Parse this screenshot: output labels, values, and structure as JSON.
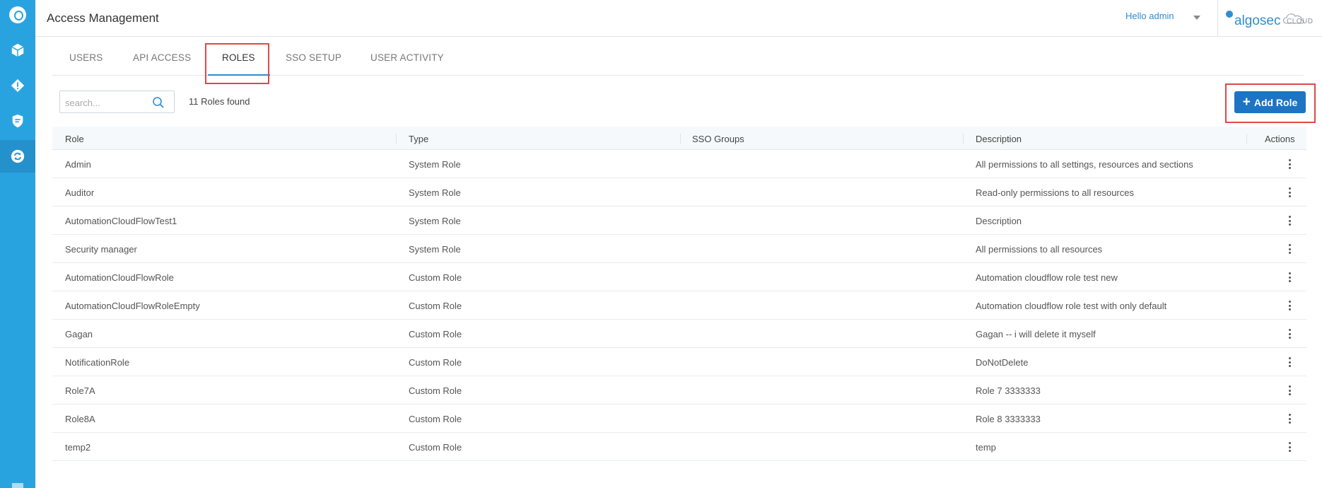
{
  "header": {
    "title": "Access Management",
    "user_greeting": "Hello admin",
    "brand_name": "algosec",
    "brand_suffix": "CLOUD"
  },
  "sidebar": {
    "items": [
      {
        "icon": "cube-icon"
      },
      {
        "icon": "alert-diamond-icon"
      },
      {
        "icon": "shield-icon"
      },
      {
        "icon": "refresh-icon"
      }
    ],
    "active_index": 3
  },
  "tabs": [
    {
      "label": "USERS"
    },
    {
      "label": "API ACCESS"
    },
    {
      "label": "ROLES"
    },
    {
      "label": "SSO SETUP"
    },
    {
      "label": "USER ACTIVITY"
    }
  ],
  "active_tab": "ROLES",
  "search": {
    "placeholder": "search...",
    "value": ""
  },
  "results_count": "11 Roles found",
  "add_button": {
    "label": "Add Role"
  },
  "table": {
    "columns": [
      "Role",
      "Type",
      "SSO Groups",
      "Description",
      "Actions"
    ],
    "rows": [
      {
        "role": "Admin",
        "type": "System Role",
        "sso_groups": "",
        "description": "All permissions to all settings, resources and sections"
      },
      {
        "role": "Auditor",
        "type": "System Role",
        "sso_groups": "",
        "description": "Read-only permissions to all resources"
      },
      {
        "role": "AutomationCloudFlowTest1",
        "type": "System Role",
        "sso_groups": "",
        "description": "Description"
      },
      {
        "role": "Security manager",
        "type": "System Role",
        "sso_groups": "",
        "description": "All permissions to all resources"
      },
      {
        "role": "AutomationCloudFlowRole",
        "type": "Custom Role",
        "sso_groups": "",
        "description": "Automation cloudflow role test new"
      },
      {
        "role": "AutomationCloudFlowRoleEmpty",
        "type": "Custom Role",
        "sso_groups": "",
        "description": "Automation cloudflow role test with only default"
      },
      {
        "role": "Gagan",
        "type": "Custom Role",
        "sso_groups": "",
        "description": "Gagan -- i will delete it myself"
      },
      {
        "role": "NotificationRole",
        "type": "Custom Role",
        "sso_groups": "",
        "description": "DoNotDelete"
      },
      {
        "role": "Role7A",
        "type": "Custom Role",
        "sso_groups": "",
        "description": "Role 7 3333333"
      },
      {
        "role": "Role8A",
        "type": "Custom Role",
        "sso_groups": "",
        "description": "Role 8 3333333"
      },
      {
        "role": "temp2",
        "type": "Custom Role",
        "sso_groups": "",
        "description": "temp"
      }
    ]
  },
  "colors": {
    "sidebar": "#29a3e0",
    "accent": "#2f8dd1",
    "button": "#1d74c4",
    "highlight": "#e04848"
  }
}
